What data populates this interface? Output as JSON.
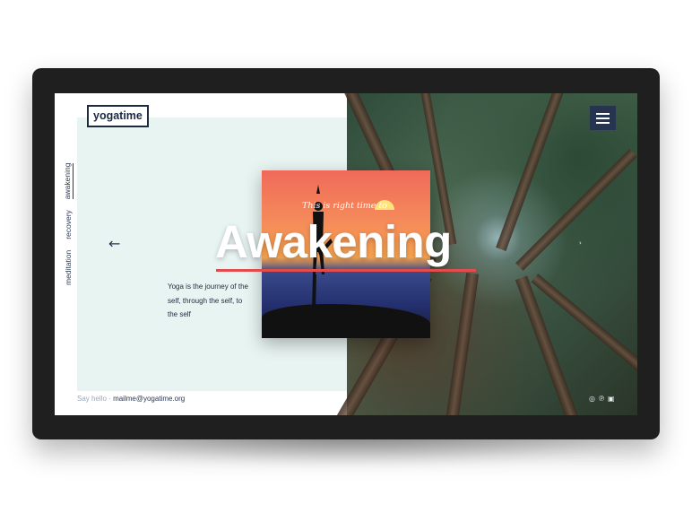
{
  "brand": {
    "logo": "yogatime"
  },
  "nav": {
    "items": [
      {
        "label": "meditation",
        "active": false
      },
      {
        "label": "recovery",
        "active": false
      },
      {
        "label": "awakening",
        "active": true
      }
    ]
  },
  "hero": {
    "tagline": "This is right time to",
    "title": "Awakening",
    "description": "Yoga is the journey of the self, through the self, to the self",
    "accent_color": "#e24c4c"
  },
  "footer": {
    "say_hello": "Say hello",
    "separator": "·",
    "email": "mailme@yogatime.org"
  },
  "controls": {
    "prev_arrow": "←",
    "next_arrow": "›",
    "menu_icon": "hamburger-icon",
    "social_icons": [
      "instagram-icon",
      "pinterest-icon",
      "facebook-icon"
    ]
  },
  "colors": {
    "navy": "#1b2a40",
    "panel": "#e8f4f2",
    "menu_bg": "#27344f"
  }
}
